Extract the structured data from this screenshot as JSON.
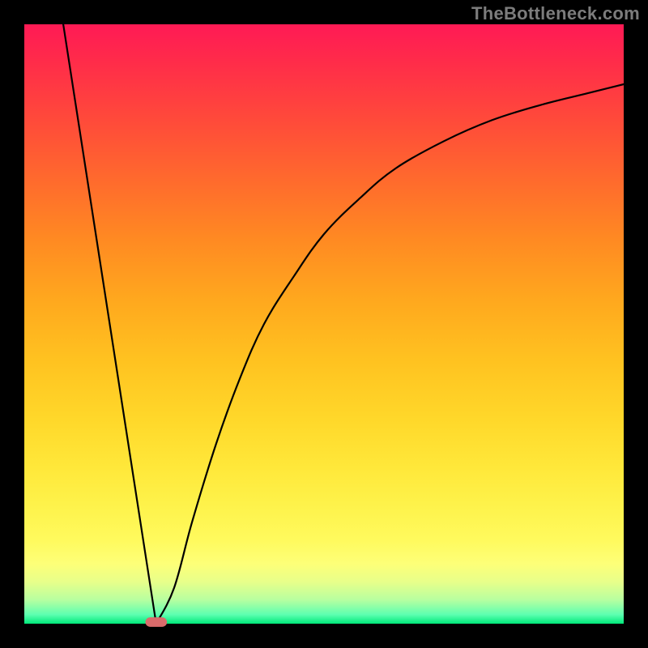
{
  "watermark": "TheBottleneck.com",
  "chart_data": {
    "type": "line",
    "title": "",
    "xlabel": "",
    "ylabel": "",
    "xlim": [
      0,
      100
    ],
    "ylim": [
      0,
      100
    ],
    "legend": false,
    "grid": false,
    "background": "red-yellow-green vertical gradient",
    "curve": {
      "description": "V-shaped bottleneck curve: steep linear descent from top-left to a minimum near x≈22, then asymptotic rise toward top-right",
      "minimum_x": 22,
      "minimum_y": 0,
      "points": [
        {
          "x": 6.5,
          "y": 100
        },
        {
          "x": 22,
          "y": 0
        },
        {
          "x": 25,
          "y": 6
        },
        {
          "x": 28,
          "y": 17
        },
        {
          "x": 32,
          "y": 30
        },
        {
          "x": 36,
          "y": 41
        },
        {
          "x": 40,
          "y": 50
        },
        {
          "x": 45,
          "y": 58
        },
        {
          "x": 50,
          "y": 65
        },
        {
          "x": 56,
          "y": 71
        },
        {
          "x": 62,
          "y": 76
        },
        {
          "x": 70,
          "y": 80.5
        },
        {
          "x": 78,
          "y": 84
        },
        {
          "x": 86,
          "y": 86.5
        },
        {
          "x": 94,
          "y": 88.5
        },
        {
          "x": 100,
          "y": 90
        }
      ]
    },
    "marker": {
      "shape": "rounded-rect",
      "color": "#d96b6b",
      "x": 22,
      "y": 0,
      "width_pct": 3.6,
      "height_pct": 1.6
    }
  }
}
